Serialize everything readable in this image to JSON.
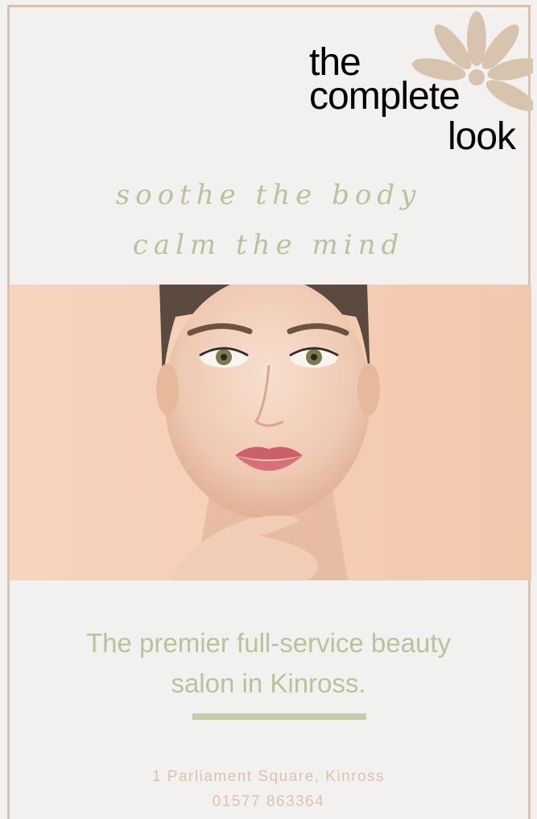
{
  "logo": {
    "line1": "the",
    "line2": "complete",
    "line3": "look"
  },
  "tagline": {
    "line1": "soothe the body",
    "line2": "calm the mind"
  },
  "headline": {
    "line1": "The premier full-service beauty",
    "line2": "salon in Kinross."
  },
  "contact": {
    "address": "1 Parliament Square, Kinross",
    "phone": "01577 863364"
  },
  "colors": {
    "accent": "#b9c39b",
    "logo": "#d8c4ae",
    "frame": "#d7c3b4",
    "background": "#f2f1ef",
    "hero": "#f5d0b8"
  },
  "icons": {
    "logo_mark": "flower-icon"
  }
}
